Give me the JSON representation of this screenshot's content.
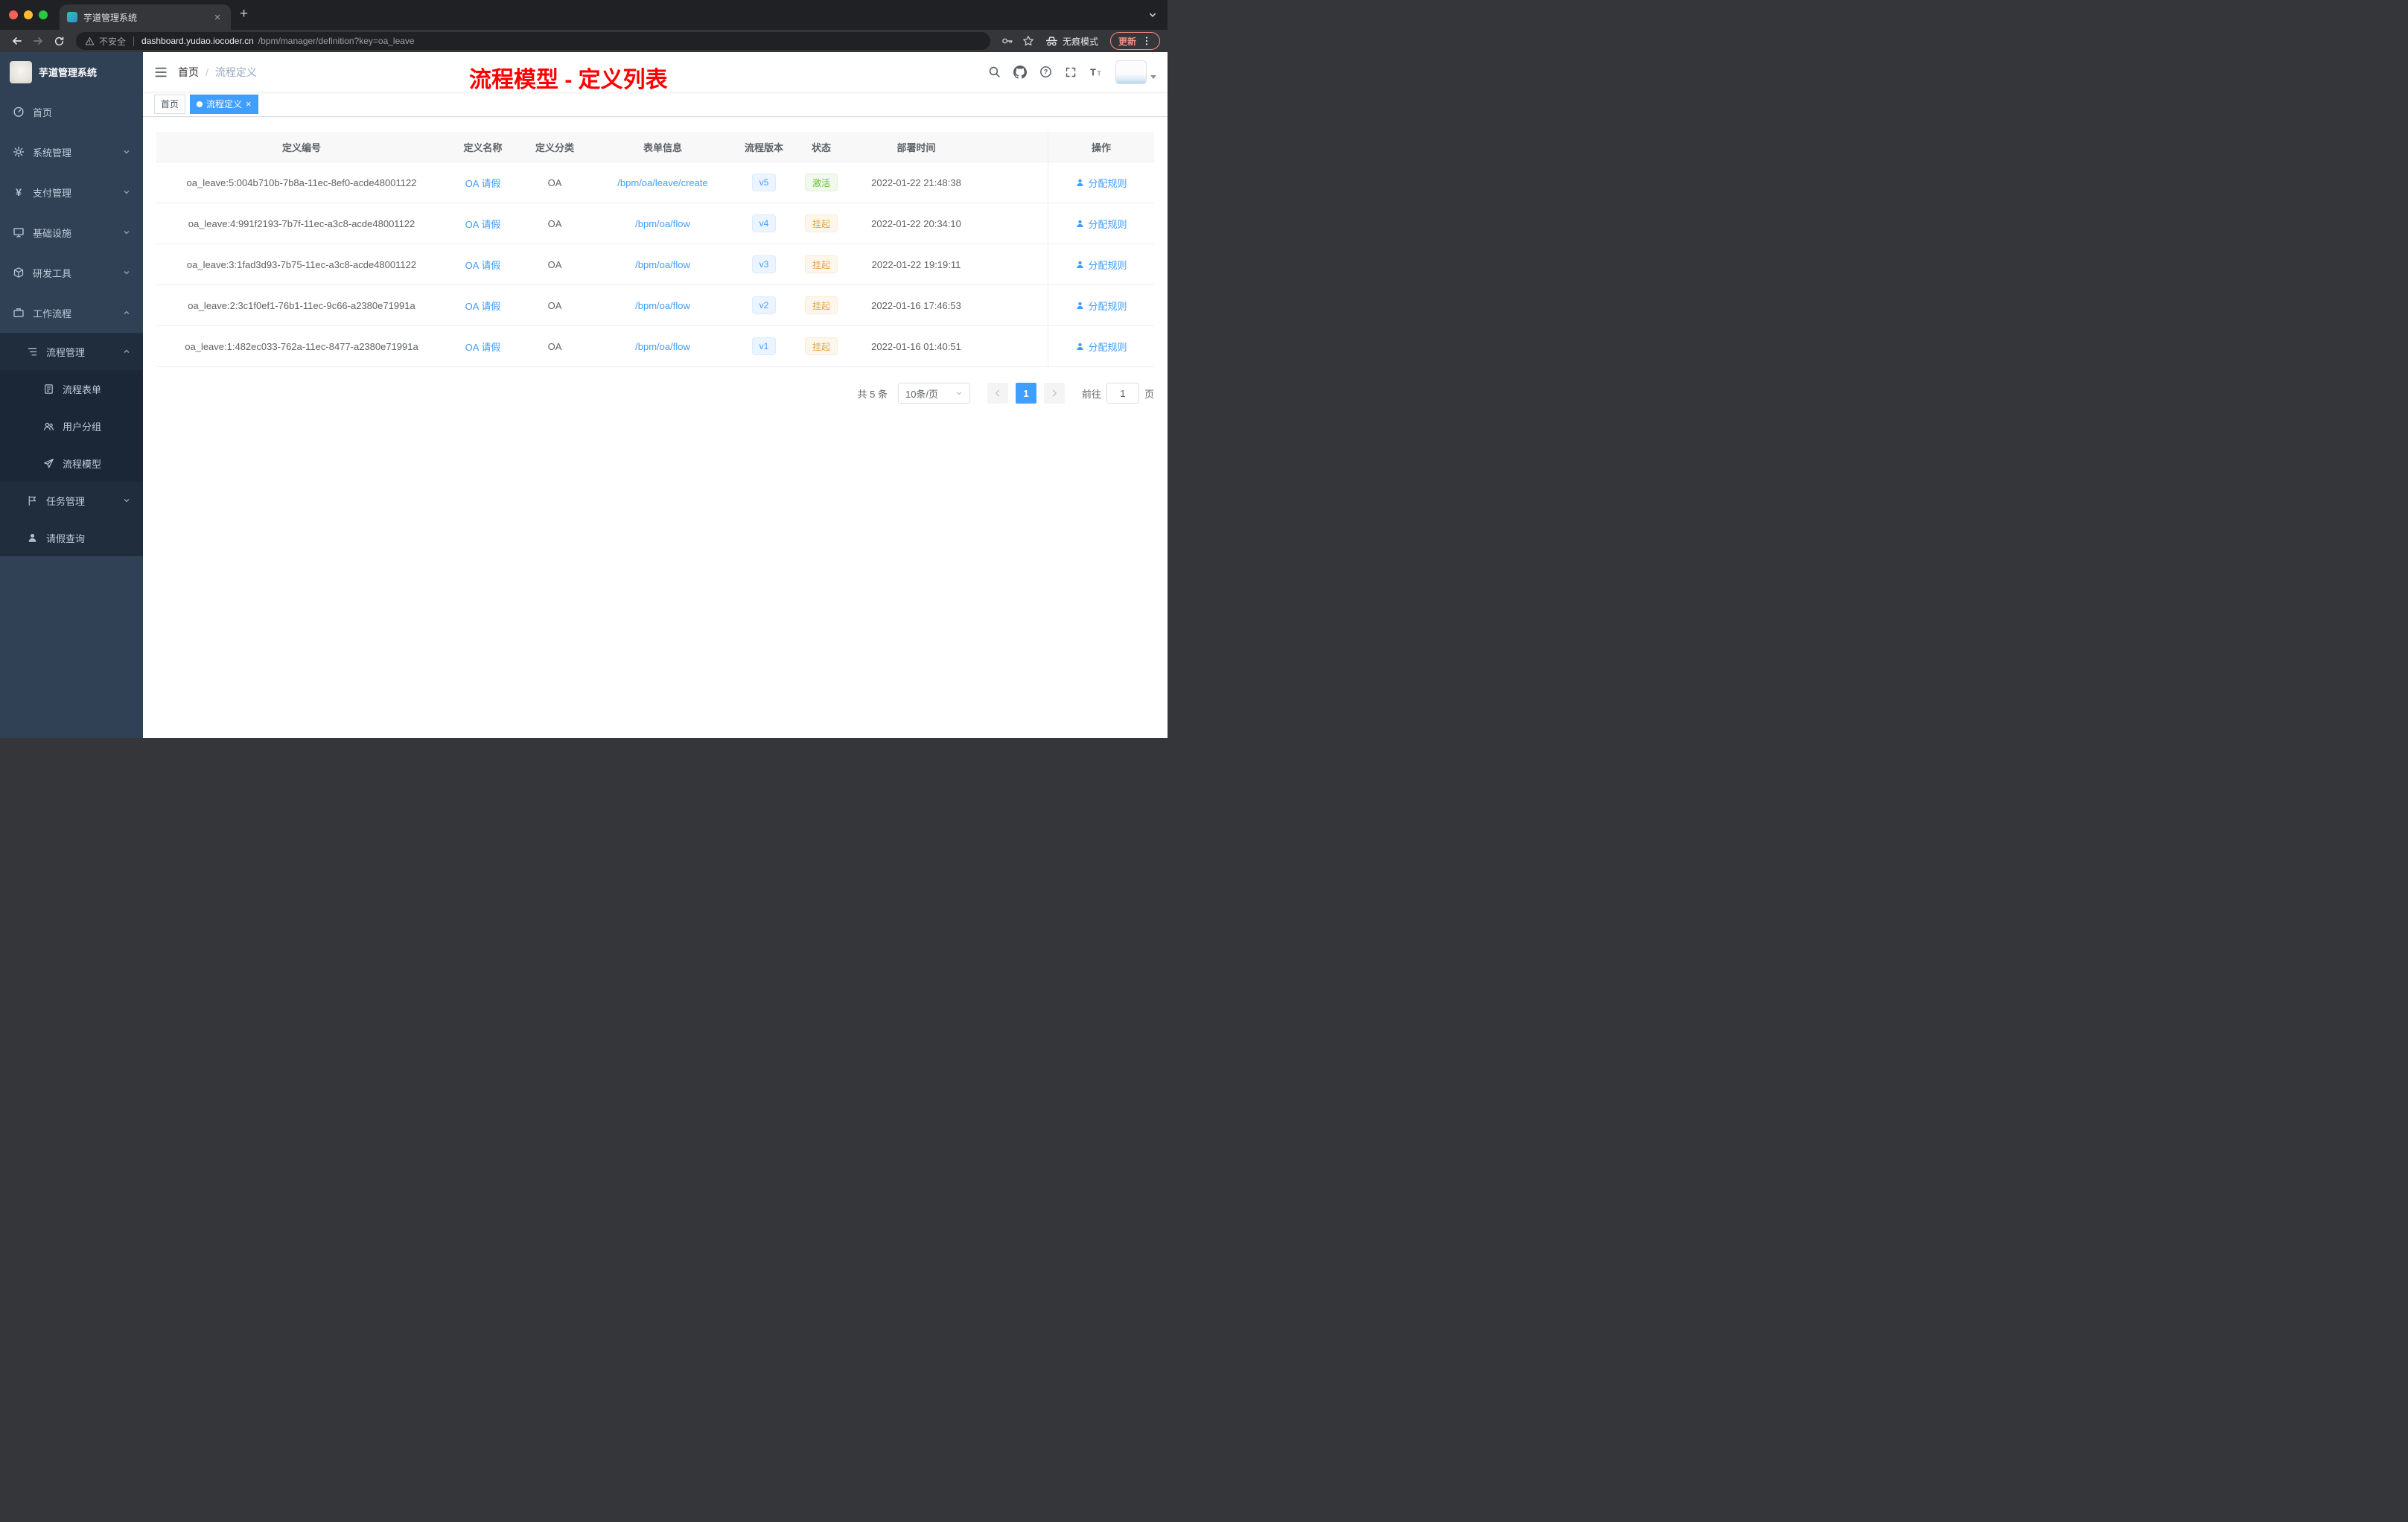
{
  "browser": {
    "tab_title": "芋道管理系统",
    "security_label": "不安全",
    "url_host": "dashboard.yudao.iocoder.cn",
    "url_path": "/bpm/manager/definition?key=oa_leave",
    "incognito_label": "无痕模式",
    "update_label": "更新"
  },
  "annotation": {
    "text": "流程模型 - 定义列表"
  },
  "sidebar": {
    "logo_title": "芋道管理系统",
    "items": [
      "首页",
      "系统管理",
      "支付管理",
      "基础设施",
      "研发工具",
      "工作流程"
    ],
    "workflow_children": [
      "流程管理",
      "任务管理",
      "请假查询"
    ],
    "process_children": [
      "流程表单",
      "用户分组",
      "流程模型"
    ]
  },
  "navbar": {
    "breadcrumb_home": "首页",
    "breadcrumb_current": "流程定义"
  },
  "tags": {
    "home": "首页",
    "current": "流程定义"
  },
  "table": {
    "headers": [
      "定义编号",
      "定义名称",
      "定义分类",
      "表单信息",
      "流程版本",
      "状态",
      "部署时间",
      "操作"
    ],
    "rows": [
      {
        "id": "oa_leave:5:004b710b-7b8a-11ec-8ef0-acde48001122",
        "name": "OA 请假",
        "category": "OA",
        "form": "/bpm/oa/leave/create",
        "version": "v5",
        "status": "激活",
        "status_type": "success",
        "deployed": "2022-01-22 21:48:38",
        "action": "分配规则"
      },
      {
        "id": "oa_leave:4:991f2193-7b7f-11ec-a3c8-acde48001122",
        "name": "OA 请假",
        "category": "OA",
        "form": "/bpm/oa/flow",
        "version": "v4",
        "status": "挂起",
        "status_type": "warning",
        "deployed": "2022-01-22 20:34:10",
        "action": "分配规则"
      },
      {
        "id": "oa_leave:3:1fad3d93-7b75-11ec-a3c8-acde48001122",
        "name": "OA 请假",
        "category": "OA",
        "form": "/bpm/oa/flow",
        "version": "v3",
        "status": "挂起",
        "status_type": "warning",
        "deployed": "2022-01-22 19:19:11",
        "action": "分配规则"
      },
      {
        "id": "oa_leave:2:3c1f0ef1-76b1-11ec-9c66-a2380e71991a",
        "name": "OA 请假",
        "category": "OA",
        "form": "/bpm/oa/flow",
        "version": "v2",
        "status": "挂起",
        "status_type": "warning",
        "deployed": "2022-01-16 17:46:53",
        "action": "分配规则"
      },
      {
        "id": "oa_leave:1:482ec033-762a-11ec-8477-a2380e71991a",
        "name": "OA 请假",
        "category": "OA",
        "form": "/bpm/oa/flow",
        "version": "v1",
        "status": "挂起",
        "status_type": "warning",
        "deployed": "2022-01-16 01:40:51",
        "action": "分配规则"
      }
    ]
  },
  "pagination": {
    "total": "共 5 条",
    "page_size": "10条/页",
    "current_page": "1",
    "goto_label": "前往",
    "goto_value": "1",
    "page_unit": "页"
  },
  "colors": {
    "accent": "#409eff",
    "success": "#67c23a",
    "warning": "#e6a23c",
    "sidebar_bg": "#304156",
    "annotation": "#ff0000"
  },
  "icons": {
    "browser": [
      "warning-icon",
      "key-icon",
      "star-icon",
      "incognito-icon",
      "menu-dots-icon",
      "back-icon",
      "forward-icon",
      "reload-icon",
      "plus-icon",
      "close-icon",
      "chevron-down-icon"
    ],
    "sidebar": [
      "dashboard-icon",
      "gear-icon",
      "yen-icon",
      "monitor-icon",
      "cube-icon",
      "briefcase-icon",
      "list-tree-icon",
      "form-icon",
      "user-group-icon",
      "paper-plane-icon",
      "flag-icon",
      "user-icon"
    ],
    "navbar": [
      "hamburger-icon",
      "search-icon",
      "github-icon",
      "question-icon",
      "fullscreen-icon",
      "font-size-icon",
      "caret-down-icon"
    ]
  }
}
